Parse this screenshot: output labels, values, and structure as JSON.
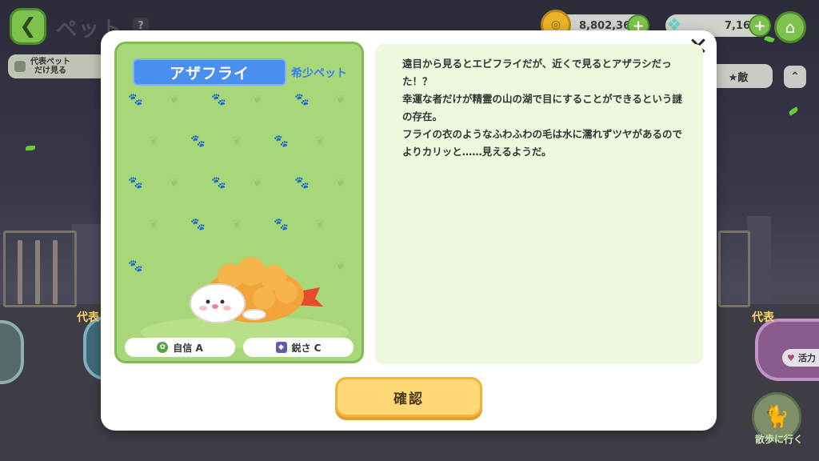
{
  "header": {
    "title": "ペット",
    "help_label": "?",
    "gold": "8,802,360",
    "gems": "7,168"
  },
  "filter": {
    "label": "代表ペット\nだけ見る"
  },
  "sort": {
    "label": "★敵",
    "direction": "⌃"
  },
  "background": {
    "rep_tag_left": "代表",
    "rep_tag_right": "代表",
    "vitality_label": "活力",
    "walk_label": "散歩に行く"
  },
  "modal": {
    "close_label": "✕",
    "pet_name": "アザフライ",
    "rarity": "希少ペット",
    "stats": [
      {
        "label": "自信 A",
        "color": "#5aa04a"
      },
      {
        "label": "鋭さ C",
        "color": "#5c5ca8"
      }
    ],
    "description": "遠目から見るとエビフライだが、近くで見るとアザラシだった！？\n幸運な者だけが精霊の山の湖で目にすることができるという謎の存在。\nフライの衣のようなふわふわの毛は水に濡れずツヤがあるのでよりカリッと……見えるようだ。",
    "confirm_label": "確認"
  }
}
